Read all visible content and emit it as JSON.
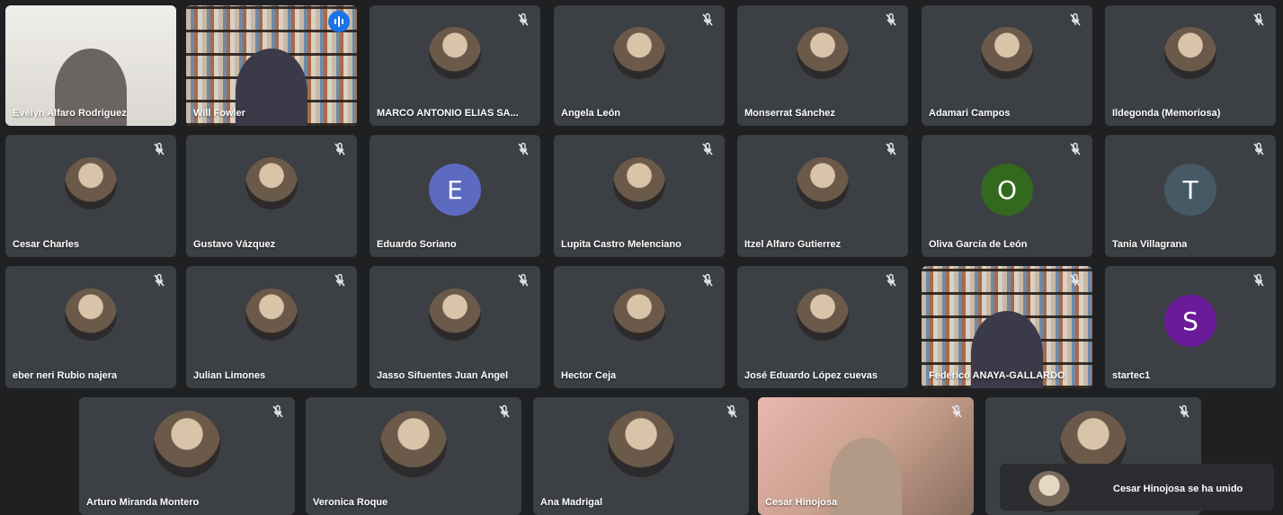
{
  "participants": [
    {
      "name": "Evelyn Alfaro Rodriguez",
      "type": "video",
      "bg": "room"
    },
    {
      "name": "Will Fowler",
      "type": "video",
      "bg": "shelves",
      "active": true
    },
    {
      "name": "MARCO ANTONIO ELIAS SA...",
      "type": "photo"
    },
    {
      "name": "Angela León",
      "type": "photo"
    },
    {
      "name": "Monserrat Sánchez",
      "type": "photo"
    },
    {
      "name": "Adamari Campos",
      "type": "photo"
    },
    {
      "name": "Ildegonda (Memoriosa)",
      "type": "photo"
    },
    {
      "name": "Cesar Charles",
      "type": "photo"
    },
    {
      "name": "Gustavo Vázquez",
      "type": "photo"
    },
    {
      "name": "Eduardo Soriano",
      "type": "letter",
      "letter": "E",
      "color": "#5c6bc0"
    },
    {
      "name": "Lupita Castro Melenciano",
      "type": "photo"
    },
    {
      "name": "Itzel Alfaro Gutierrez",
      "type": "photo"
    },
    {
      "name": "Oliva García de León",
      "type": "letter",
      "letter": "O",
      "color": "#33691e"
    },
    {
      "name": "Tania Villagrana",
      "type": "letter",
      "letter": "T",
      "color": "#455a64"
    },
    {
      "name": "eber neri Rubio najera",
      "type": "photo"
    },
    {
      "name": "Julian Limones",
      "type": "photo"
    },
    {
      "name": "Jasso Sifuentes Juan Ángel",
      "type": "photo"
    },
    {
      "name": "Hector Ceja",
      "type": "photo"
    },
    {
      "name": "José Eduardo López cuevas",
      "type": "photo"
    },
    {
      "name": "Federico ANAYA-GALLARDO",
      "type": "video",
      "bg": "shelves"
    },
    {
      "name": "startec1",
      "type": "letter",
      "letter": "S",
      "color": "#6a1b9a"
    },
    {
      "name": "Arturo Miranda Montero",
      "type": "photo"
    },
    {
      "name": "Veronica Roque",
      "type": "photo"
    },
    {
      "name": "Ana Madrigal",
      "type": "photo"
    },
    {
      "name": "Cesar Hinojosa",
      "type": "video",
      "bg": "pink"
    },
    {
      "name": "",
      "type": "photo"
    }
  ],
  "notification": {
    "text": "Cesar Hinojosa se ha unido"
  },
  "icons": {
    "muted": "mic-off-icon",
    "speaking": "audio-level-icon"
  }
}
